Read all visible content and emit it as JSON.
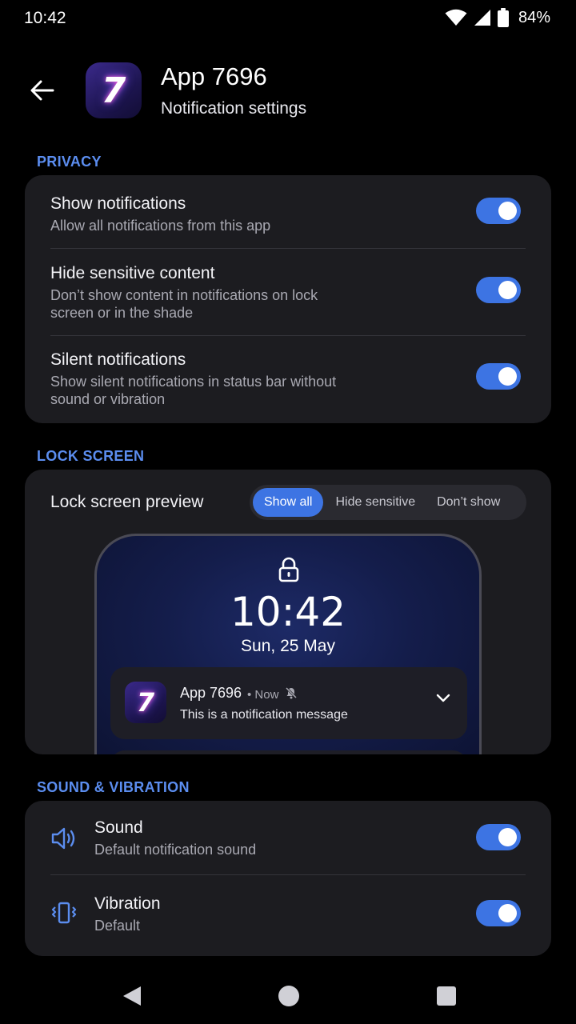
{
  "status_bar": {
    "time": "10:42",
    "battery": "84%",
    "icons": [
      "wifi-icon",
      "signal-icon",
      "battery-icon"
    ]
  },
  "header": {
    "app_name": "App 7696",
    "subtitle": "Notification settings",
    "app_icon_glyph": "7"
  },
  "privacy": {
    "section_label": "PRIVACY",
    "rows": [
      {
        "title": "Show notifications",
        "desc": "Allow all notifications from this app",
        "enabled": true
      },
      {
        "title": "Hide sensitive content",
        "desc": "Don’t show content in notifications on lock screen or in the shade",
        "enabled": true
      },
      {
        "title": "Silent notifications",
        "desc": "Show silent notifications in status bar without sound or vibration",
        "enabled": true
      }
    ]
  },
  "lock_screen": {
    "section_label": "LOCK SCREEN",
    "preview_label": "Lock screen preview",
    "options": [
      "Show all",
      "Hide sensitive",
      "Don’t show"
    ],
    "selected": "Show all",
    "preview": {
      "time": "10:42",
      "date": "Sun, 25 May",
      "notification": {
        "app": "App 7696",
        "meta": "• Now",
        "message": "This is a notification message"
      }
    }
  },
  "sound_vibration": {
    "section_label": "SOUND & VIBRATION",
    "rows": [
      {
        "title": "Sound",
        "desc": "Default notification sound",
        "icon": "speaker-icon",
        "enabled": true
      },
      {
        "title": "Vibration",
        "desc": "Default",
        "icon": "vibration-icon",
        "enabled": true
      }
    ]
  },
  "colors": {
    "accent": "#3D74E3",
    "section_label": "#5B8DEF",
    "card": "#1C1C20",
    "background": "#000000"
  }
}
